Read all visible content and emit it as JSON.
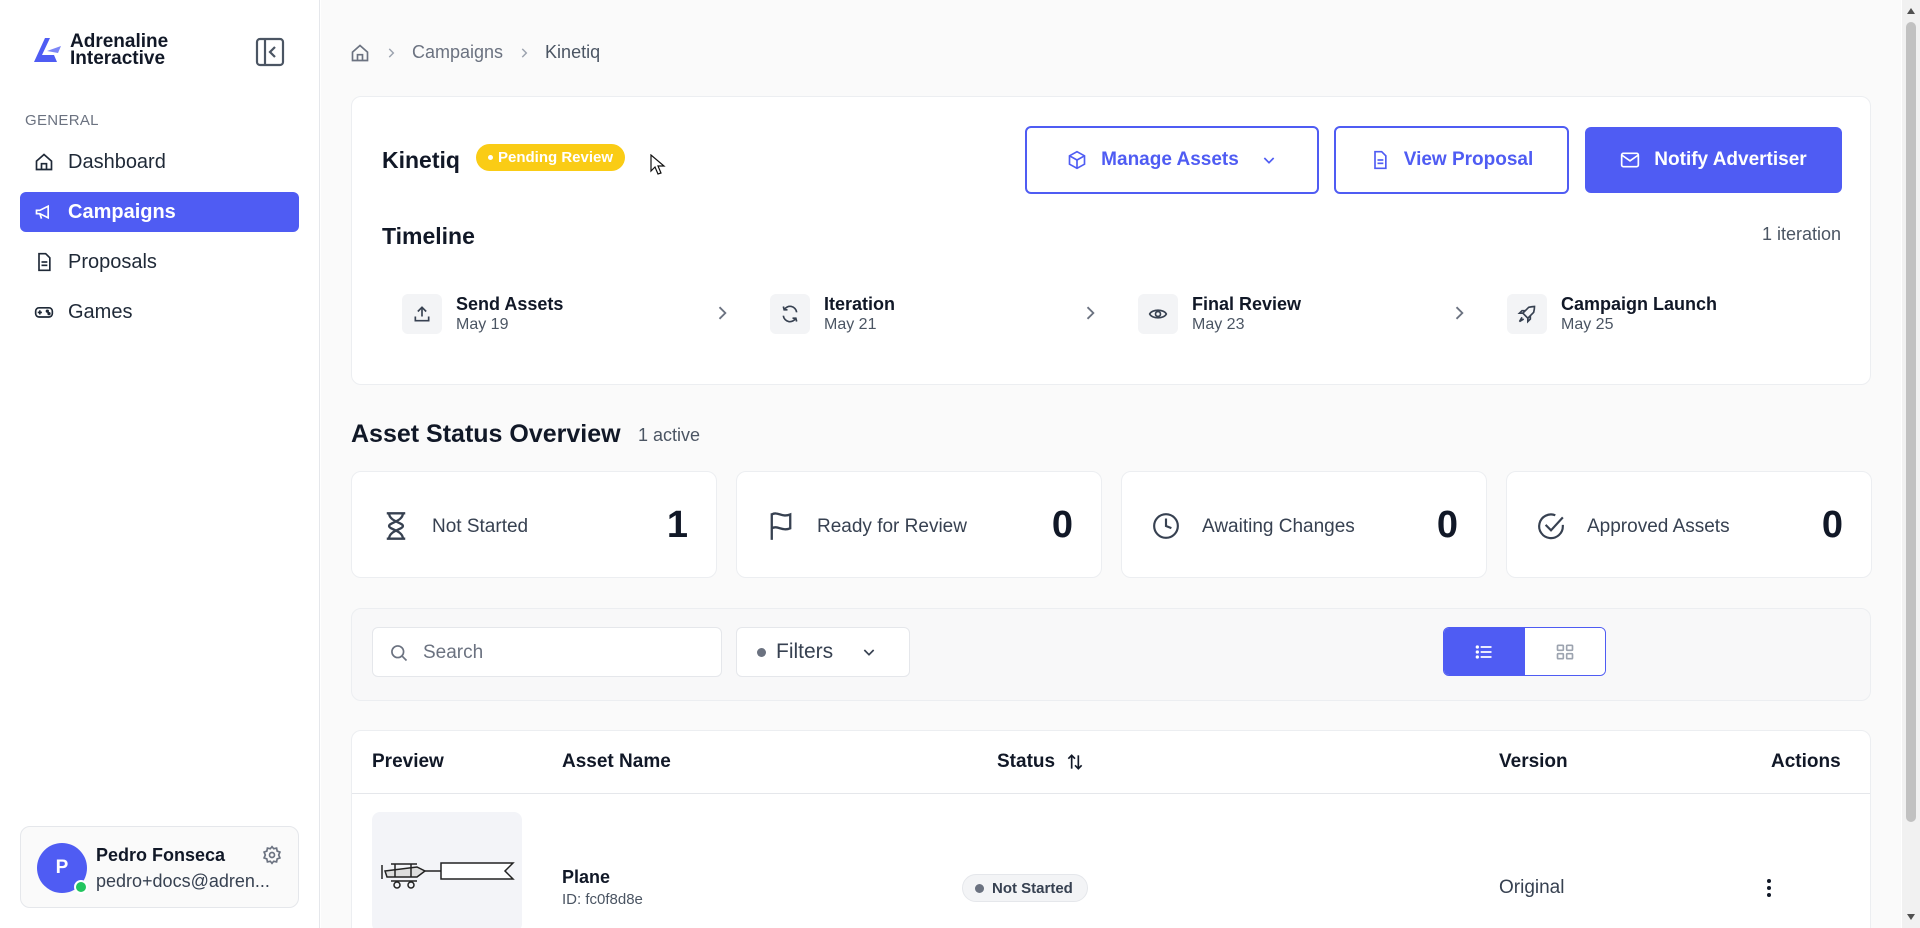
{
  "brand": {
    "name_line1": "Adrenaline",
    "name_line2": "Interactive"
  },
  "sidebar": {
    "section_label": "GENERAL",
    "items": [
      {
        "label": "Dashboard",
        "icon": "home-icon",
        "active": false
      },
      {
        "label": "Campaigns",
        "icon": "megaphone-icon",
        "active": true
      },
      {
        "label": "Proposals",
        "icon": "document-icon",
        "active": false
      },
      {
        "label": "Games",
        "icon": "gamepad-icon",
        "active": false
      }
    ]
  },
  "user": {
    "initial": "P",
    "name": "Pedro Fonseca",
    "email": "pedro+docs@adren...",
    "status": "online"
  },
  "breadcrumb": {
    "items": [
      "Campaigns",
      "Kinetiq"
    ]
  },
  "campaign": {
    "title": "Kinetiq",
    "status_badge": "Pending Review",
    "actions": {
      "manage_assets": "Manage Assets",
      "view_proposal": "View Proposal",
      "notify_advertiser": "Notify Advertiser"
    }
  },
  "timeline": {
    "title": "Timeline",
    "iteration_count": "1 iteration",
    "steps": [
      {
        "name": "Send Assets",
        "date": "May 19",
        "icon": "upload-icon"
      },
      {
        "name": "Iteration",
        "date": "May 21",
        "icon": "refresh-icon"
      },
      {
        "name": "Final Review",
        "date": "May 23",
        "icon": "eye-icon"
      },
      {
        "name": "Campaign Launch",
        "date": "May 25",
        "icon": "rocket-icon"
      }
    ]
  },
  "overview": {
    "title": "Asset Status Overview",
    "active_count": "1 active",
    "stats": [
      {
        "label": "Not Started",
        "value": "1",
        "icon": "hourglass-icon"
      },
      {
        "label": "Ready for Review",
        "value": "0",
        "icon": "flag-icon"
      },
      {
        "label": "Awaiting Changes",
        "value": "0",
        "icon": "clock-icon"
      },
      {
        "label": "Approved Assets",
        "value": "0",
        "icon": "check-circle-icon"
      }
    ]
  },
  "filters": {
    "search_placeholder": "Search",
    "filters_label": "Filters",
    "view_mode": "list"
  },
  "table": {
    "columns": [
      "Preview",
      "Asset Name",
      "Status",
      "Version",
      "Actions"
    ],
    "rows": [
      {
        "name": "Plane",
        "id": "ID: fc0f8d8e",
        "status": "Not Started",
        "version": "Original"
      }
    ]
  },
  "colors": {
    "accent": "#4f5cf3",
    "pending": "#facc15",
    "online": "#22c55e"
  }
}
